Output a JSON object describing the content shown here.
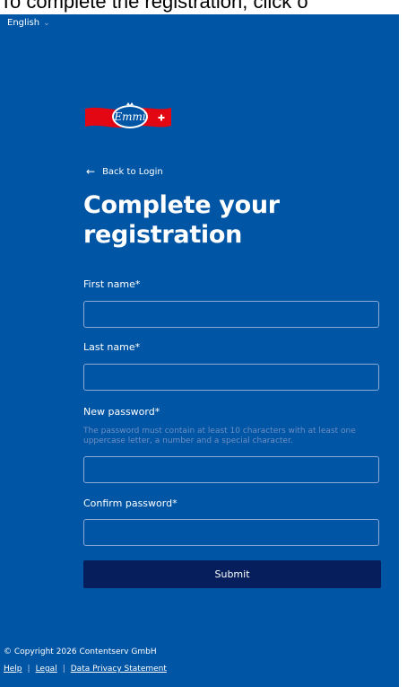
{
  "caption": {
    "text": "To complete the registration, click o"
  },
  "language": {
    "label": "English",
    "chevron_icon": "chevron-down-icon"
  },
  "brand": {
    "logo_text": "Emmi",
    "logo_icon": "emmi-logo"
  },
  "nav": {
    "back_label": "Back to Login",
    "back_icon": "arrow-left-icon"
  },
  "form": {
    "title": "Complete your registration",
    "first_name": {
      "label": "First name*",
      "value": ""
    },
    "last_name": {
      "label": "Last name*",
      "value": ""
    },
    "new_password": {
      "label": "New password*",
      "hint": "The password must contain at least 10 characters with at least one uppercase letter, a number and a special character.",
      "value": ""
    },
    "confirm_password": {
      "label": "Confirm password*",
      "value": ""
    },
    "submit_label": "Submit"
  },
  "footer": {
    "copyright": "© Copyright 2026 Contentserv GmbH",
    "links": [
      "Help",
      "Legal",
      "Data Privacy Statement"
    ],
    "separator": "|"
  },
  "colors": {
    "background": "#0055a5",
    "button": "#061f5c",
    "field_border": "#8aa9d6",
    "hint_text": "#6f8fc4",
    "logo_red": "#e30613"
  }
}
